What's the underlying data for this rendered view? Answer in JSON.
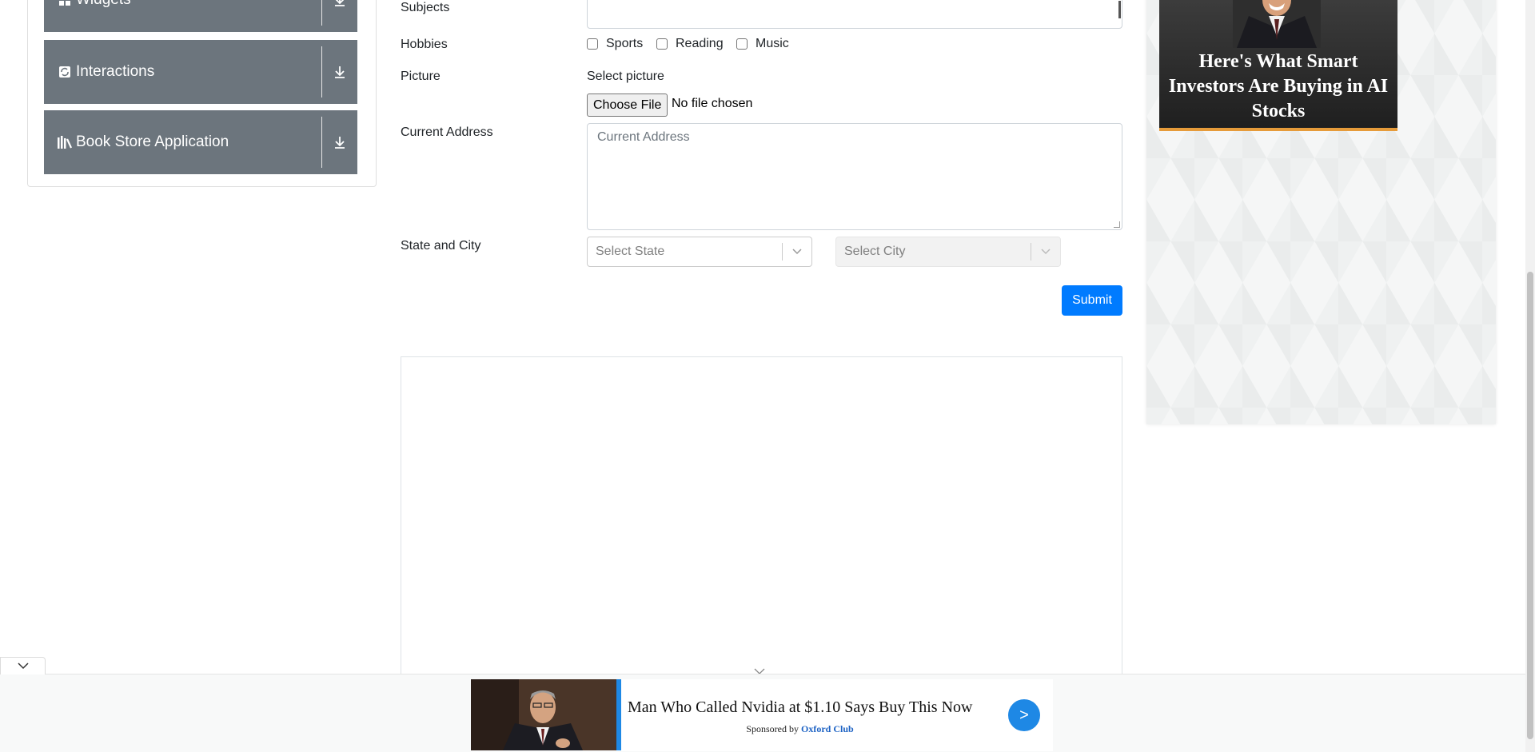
{
  "sidebar": {
    "groups": [
      {
        "label": "Widgets",
        "icon": "widgets-icon"
      },
      {
        "label": "Interactions",
        "icon": "interactions-icon"
      },
      {
        "label": "Book Store Application",
        "icon": "book-store-icon"
      }
    ]
  },
  "form": {
    "subjects_label": "Subjects",
    "hobbies_label": "Hobbies",
    "hobbies": [
      "Sports",
      "Reading",
      "Music"
    ],
    "picture_label": "Picture",
    "picture_prompt": "Select picture",
    "file_button": "Choose File",
    "file_status": "No file chosen",
    "address_label": "Current Address",
    "address_placeholder": "Current Address",
    "state_city_label": "State and City",
    "state_placeholder": "Select State",
    "city_placeholder": "Select City",
    "submit_label": "Submit"
  },
  "ads": {
    "right_headline": "Here's What Smart Investors Are Buying in AI Stocks",
    "bottom_title": "Man Who Called Nvidia at $1.10 Says Buy This Now",
    "bottom_sponsored_prefix": "Sponsored by",
    "bottom_sponsor": "Oxford Club",
    "bottom_cta": ">"
  },
  "colors": {
    "accent": "#007bff",
    "sidebar_group": "#6c757d",
    "ad_blue": "#1e88e5"
  }
}
